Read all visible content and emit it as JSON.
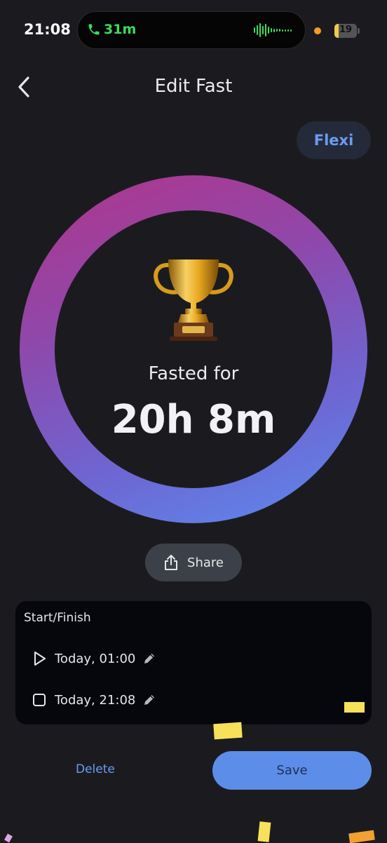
{
  "status_bar": {
    "time": "21:08",
    "call_duration": "31m",
    "battery_level": "19",
    "colors": {
      "call": "#3ddc5c",
      "indicator": "#f59a23",
      "battery": "#f2c94c"
    }
  },
  "header": {
    "title": "Edit Fast",
    "back_icon": "chevron-left-icon",
    "mode_button": "Flexi"
  },
  "progress": {
    "icon": "trophy-icon",
    "label": "Fasted for",
    "value": "20h 8m",
    "ring_gradient": [
      "#b1358b",
      "#9047a9",
      "#6e66d2",
      "#5b8cf0"
    ]
  },
  "share_button": {
    "label": "Share",
    "icon": "share-icon"
  },
  "start_finish": {
    "title": "Start/Finish",
    "start": {
      "icon": "play-icon",
      "value": "Today, 01:00",
      "edit_icon": "pencil-icon"
    },
    "finish": {
      "icon": "stop-square-icon",
      "value": "Today, 21:08",
      "edit_icon": "pencil-icon"
    }
  },
  "actions": {
    "delete_label": "Delete",
    "save_label": "Save",
    "accent_color": "#5c8de8"
  }
}
